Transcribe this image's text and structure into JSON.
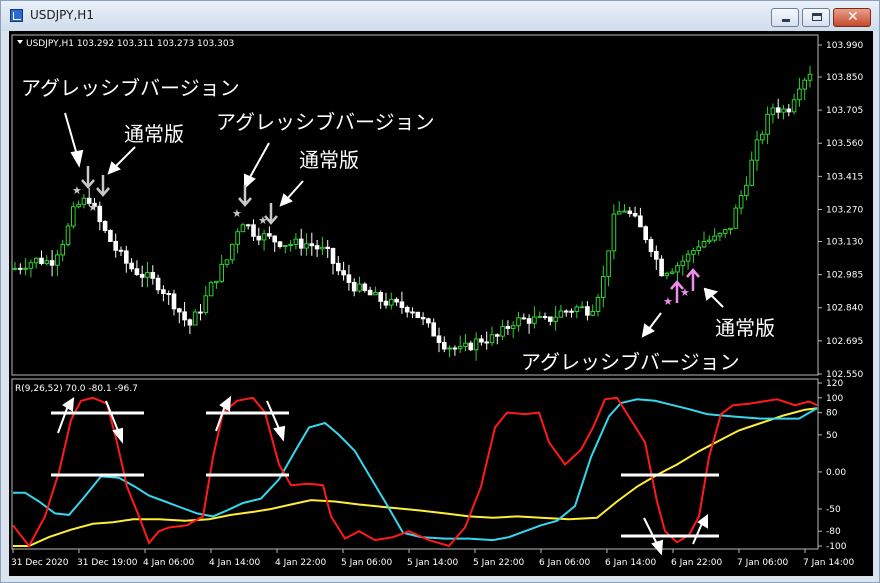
{
  "window": {
    "title": "USDJPY,H1"
  },
  "price_panel": {
    "header": "USDJPY,H1  103.292 103.311 103.273 103.303",
    "y_ticks": [
      "103.990",
      "103.850",
      "103.705",
      "103.560",
      "103.415",
      "103.270",
      "103.130",
      "102.985",
      "102.840",
      "102.695",
      "102.550"
    ]
  },
  "indicator_panel": {
    "header": "R(9,26,52) 70.0 -80.1 -96.7",
    "y_ticks": [
      "120",
      "100",
      "80",
      "50",
      "0.00",
      "-50",
      "-80",
      "-100"
    ]
  },
  "x_ticks": [
    "31 Dec 2020",
    "31 Dec 19:00",
    "4 Jan 06:00",
    "4 Jan 14:00",
    "4 Jan 22:00",
    "5 Jan 06:00",
    "5 Jan 14:00",
    "5 Jan 22:00",
    "6 Jan 06:00",
    "6 Jan 14:00",
    "6 Jan 22:00",
    "7 Jan 06:00",
    "7 Jan 14:00"
  ],
  "annotations": {
    "aggressive": "アグレッシブバージョン",
    "regular": "通常版"
  },
  "colors": {
    "background": "#000000",
    "bull": "#30d030",
    "bear": "#ffffff",
    "indicator_red": "#ff1a1a",
    "indicator_cyan": "#35d7ee",
    "indicator_yellow": "#ffee33",
    "arrow_gray": "#c8c8c8",
    "arrow_pink": "#f08cf0"
  },
  "price_scale": {
    "min": 102.55,
    "max": 103.99
  },
  "indicator_scale": {
    "min": -100,
    "max": 120
  }
}
